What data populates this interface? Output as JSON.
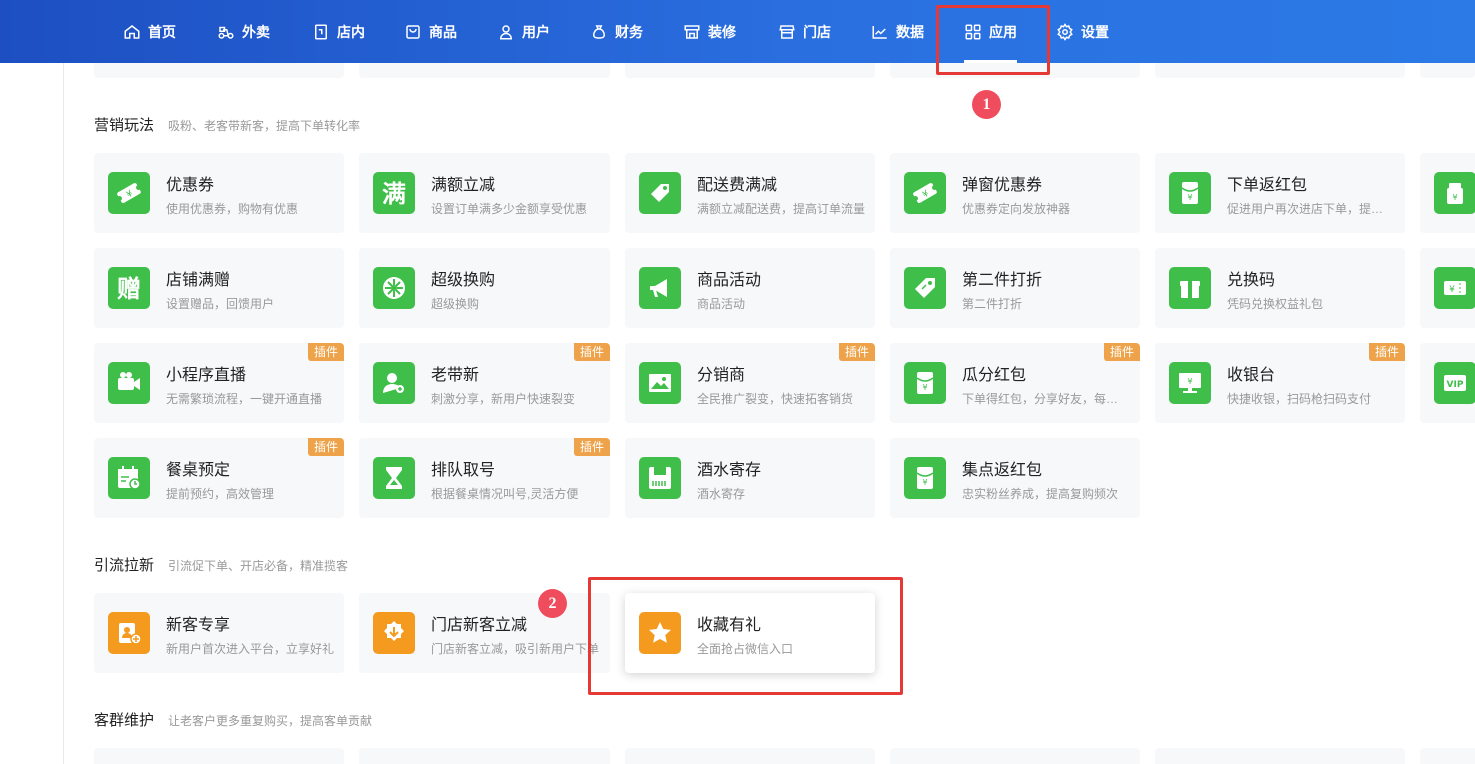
{
  "nav": {
    "items": [
      {
        "label": "首页",
        "icon": "home-icon"
      },
      {
        "label": "外卖",
        "icon": "scooter-icon"
      },
      {
        "label": "店内",
        "icon": "store-in-icon"
      },
      {
        "label": "商品",
        "icon": "product-icon"
      },
      {
        "label": "用户",
        "icon": "user-icon"
      },
      {
        "label": "财务",
        "icon": "money-bag-icon"
      },
      {
        "label": "装修",
        "icon": "shop-decor-icon"
      },
      {
        "label": "门店",
        "icon": "storefront-icon"
      },
      {
        "label": "数据",
        "icon": "chart-icon"
      },
      {
        "label": "应用",
        "icon": "apps-grid-icon",
        "active": true
      },
      {
        "label": "设置",
        "icon": "gear-icon"
      }
    ]
  },
  "sections": {
    "marketing": {
      "title": "营销玩法",
      "subtitle": "吸粉、老客带新客，提高下单转化率",
      "cards": [
        {
          "title": "优惠券",
          "desc": "使用优惠券，购物有优惠",
          "icon": "coupon-icon"
        },
        {
          "title": "满额立减",
          "desc": "设置订单满多少金额享受优惠",
          "icon": "man-char-icon"
        },
        {
          "title": "配送费满减",
          "desc": "满额立减配送费，提高订单流量",
          "icon": "price-tag-icon"
        },
        {
          "title": "弹窗优惠券",
          "desc": "优惠券定向发放神器",
          "icon": "coupon-icon"
        },
        {
          "title": "下单返红包",
          "desc": "促进用户再次进店下单，提升复购",
          "icon": "red-envelope-icon"
        },
        {
          "title": "店铺满赠",
          "desc": "设置赠品，回馈用户",
          "icon": "gift-char-icon"
        },
        {
          "title": "超级换购",
          "desc": "超级换购",
          "icon": "wheel-icon"
        },
        {
          "title": "商品活动",
          "desc": "商品活动",
          "icon": "megaphone-icon"
        },
        {
          "title": "第二件打折",
          "desc": "第二件打折",
          "icon": "discount-tag-icon"
        },
        {
          "title": "兑换码",
          "desc": "凭码兑换权益礼包",
          "icon": "gift-box-icon"
        },
        {
          "title": "小程序直播",
          "desc": "无需繁琐流程，一键开通直播",
          "icon": "video-camera-icon",
          "badge": "插件"
        },
        {
          "title": "老带新",
          "desc": "刺激分享，新用户快速裂变",
          "icon": "user-add-icon",
          "badge": "插件"
        },
        {
          "title": "分销商",
          "desc": "全民推广裂变，快速拓客销货",
          "icon": "picture-icon",
          "badge": "插件"
        },
        {
          "title": "瓜分红包",
          "desc": "下单得红包，分享好友，每人都有份",
          "icon": "red-envelope-icon",
          "badge": "插件"
        },
        {
          "title": "收银台",
          "desc": "快捷收银，扫码枪扫码支付",
          "icon": "cashier-screen-icon",
          "badge": "插件"
        },
        {
          "title": "餐桌预定",
          "desc": "提前预约，高效管理",
          "icon": "calendar-clock-icon",
          "badge": "插件"
        },
        {
          "title": "排队取号",
          "desc": "根据餐桌情况叫号,灵活方便",
          "icon": "hourglass-icon",
          "badge": "插件"
        },
        {
          "title": "酒水寄存",
          "desc": "酒水寄存",
          "icon": "storage-box-icon"
        },
        {
          "title": "集点返红包",
          "desc": "忠实粉丝养成，提高复购频次",
          "icon": "red-envelope-icon"
        }
      ],
      "partial_icons": [
        "gift-bag-icon",
        "ticket-icon",
        "vip-icon"
      ]
    },
    "traffic": {
      "title": "引流拉新",
      "subtitle": "引流促下单、开店必备，精准揽客",
      "cards": [
        {
          "title": "新客专享",
          "desc": "新用户首次进入平台，立享好礼",
          "icon": "new-customer-icon"
        },
        {
          "title": "门店新客立减",
          "desc": "门店新客立减，吸引新用户下单",
          "icon": "download-badge-icon"
        },
        {
          "title": "收藏有礼",
          "desc": "全面抢占微信入口",
          "icon": "star-icon"
        }
      ]
    },
    "retention": {
      "title": "客群维护",
      "subtitle": "让老客户更多重复购买，提高客单贡献"
    }
  },
  "annotations": {
    "step1": "1",
    "step2": "2"
  },
  "colors": {
    "nav_start": "#1d4fc2",
    "nav_end": "#2b7ae6",
    "icon_green": "#3fbf4a",
    "icon_orange": "#f39a1f",
    "badge": "#eea34a",
    "highlight": "#e53935"
  }
}
